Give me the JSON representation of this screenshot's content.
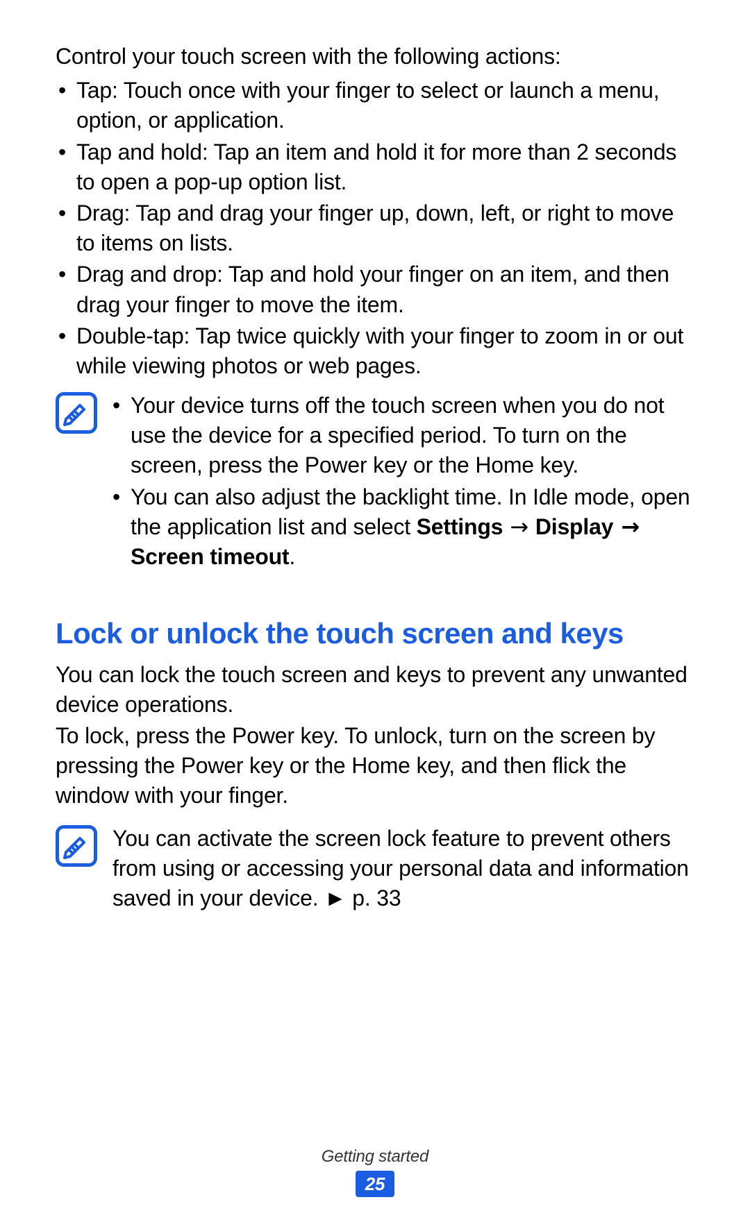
{
  "intro": "Control your touch screen with the following actions:",
  "actions": [
    "Tap: Touch once with your finger to select or launch a menu, option, or application.",
    "Tap and hold: Tap an item and hold it for more than 2 seconds to open a pop-up option list.",
    "Drag: Tap and drag your finger up, down, left, or right to move to items on lists.",
    "Drag and drop: Tap and hold your finger on an item, and then drag your finger to move the item.",
    "Double-tap: Tap twice quickly with your finger to zoom in or out while viewing photos or web pages."
  ],
  "note1": {
    "item1": "Your device turns off the touch screen when you do not use the device for a specified period. To turn on the screen, press the Power key or the Home key.",
    "item2_prefix": "You can also adjust the backlight time. In Idle mode, open the application list and select ",
    "item2_bold1": "Settings",
    "arrow": " → ",
    "item2_bold2": "Display",
    "item2_bold3": "Screen timeout",
    "period": "."
  },
  "heading": "Lock or unlock the touch screen and keys",
  "lock_para1": "You can lock the touch screen and keys to prevent any unwanted device operations.",
  "lock_para2": "To lock, press the Power key. To unlock, turn on the screen by pressing the Power key or the Home key, and then flick the window with your finger.",
  "note2_prefix": "You can activate the screen lock feature to prevent others from using or accessing your personal data and information saved in your device. ",
  "note2_ref_marker": "►",
  "note2_ref": " p. 33",
  "footer": {
    "section": "Getting started",
    "page": "25"
  },
  "icons": {
    "note": "note-icon"
  },
  "colors": {
    "accent": "#1a5de0"
  }
}
